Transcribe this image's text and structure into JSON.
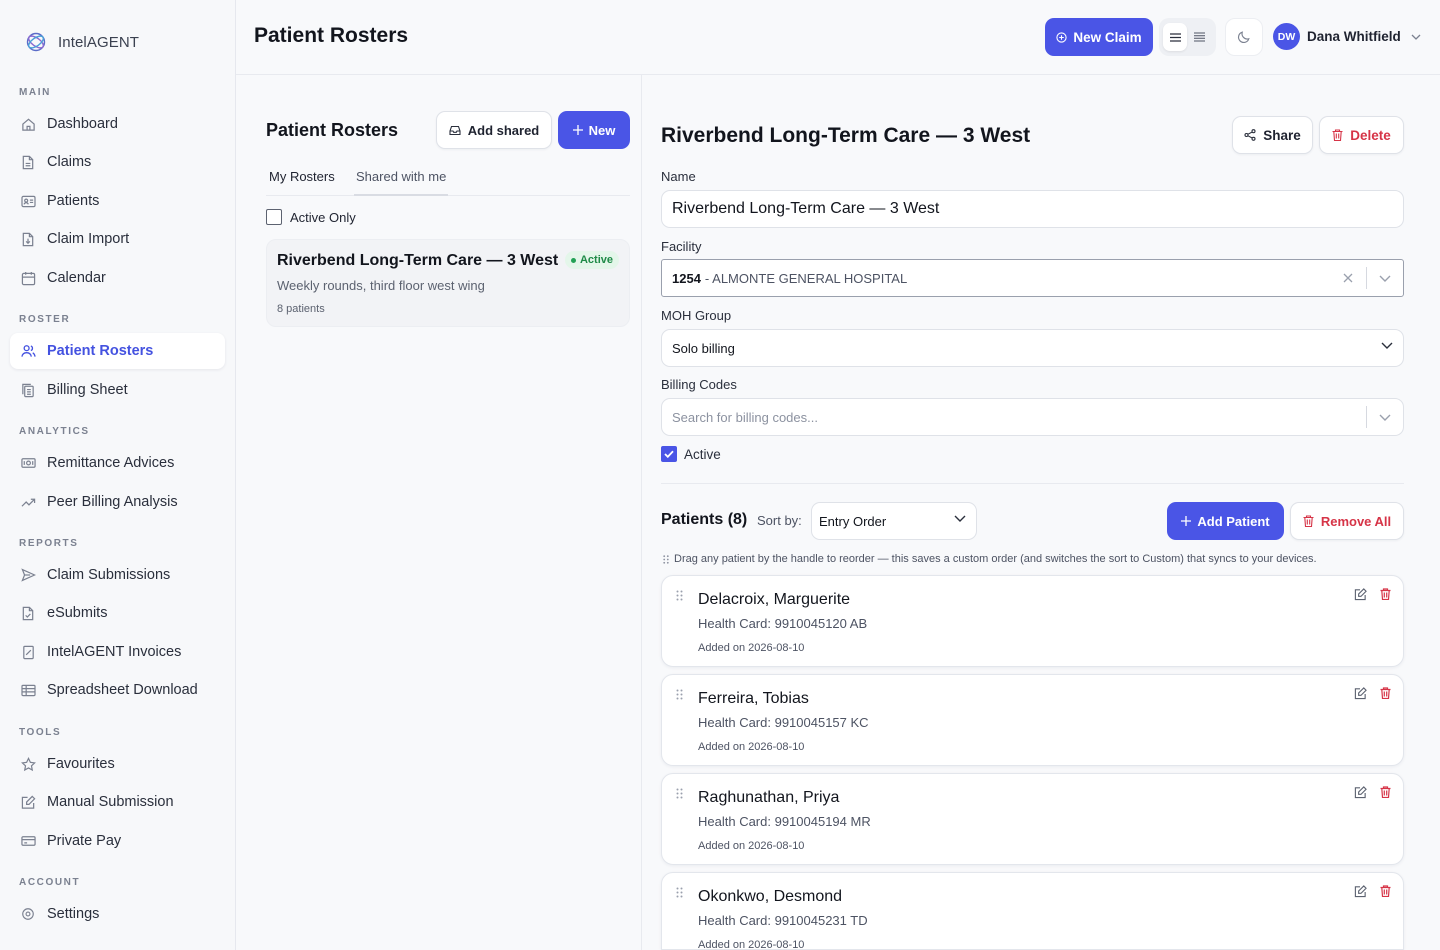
{
  "app": {
    "name": "IntelAGENT"
  },
  "header": {
    "title": "Patient Rosters",
    "new_claim": "New Claim",
    "user": {
      "initials": "DW",
      "name": "Dana Whitfield"
    }
  },
  "sidebar": {
    "sections": {
      "main": "MAIN",
      "roster": "ROSTER",
      "analytics": "ANALYTICS",
      "reports": "REPORTS",
      "tools": "TOOLS",
      "account": "ACCOUNT"
    },
    "items": {
      "dashboard": "Dashboard",
      "claims": "Claims",
      "patients": "Patients",
      "claim_import": "Claim Import",
      "calendar": "Calendar",
      "patient_rosters": "Patient Rosters",
      "billing_sheet": "Billing Sheet",
      "remittance_advices": "Remittance Advices",
      "peer_billing_analysis": "Peer Billing Analysis",
      "claim_submissions": "Claim Submissions",
      "esubmits": "eSubmits",
      "intelagent_invoices": "IntelAGENT Invoices",
      "spreadsheet_download": "Spreadsheet Download",
      "favourites": "Favourites",
      "manual_submission": "Manual Submission",
      "private_pay": "Private Pay",
      "settings": "Settings"
    }
  },
  "roster_list": {
    "title": "Patient Rosters",
    "add_shared": "Add shared",
    "new": "New",
    "tabs": {
      "my": "My Rosters",
      "shared": "Shared with me"
    },
    "active_only": "Active Only",
    "card": {
      "name": "Riverbend Long-Term Care — 3 West",
      "badge": "Active",
      "description": "Weekly rounds, third floor west wing",
      "count": "8 patients"
    }
  },
  "detail": {
    "title": "Riverbend Long-Term Care — 3 West",
    "share": "Share",
    "delete": "Delete",
    "name_label": "Name",
    "name_value": "Riverbend Long-Term Care — 3 West",
    "facility_label": "Facility",
    "facility_code": "1254",
    "facility_name": "- ALMONTE GENERAL HOSPITAL",
    "moh_label": "MOH Group",
    "moh_value": "Solo billing",
    "billing_label": "Billing Codes",
    "billing_placeholder": "Search for billing codes...",
    "active_label": "Active",
    "patients_title": "Patients (8)",
    "sort_label": "Sort by:",
    "sort_value": "Entry Order",
    "add_patient": "Add Patient",
    "remove_all": "Remove All",
    "hint": "Drag any patient by the handle to reorder — this saves a custom order (and switches the sort to Custom) that syncs to your devices."
  },
  "patients": [
    {
      "name": "Delacroix, Marguerite",
      "health_card": "Health Card: 9910045120 AB",
      "added": "Added on 2026-08-10"
    },
    {
      "name": "Ferreira, Tobias",
      "health_card": "Health Card: 9910045157 KC",
      "added": "Added on 2026-08-10"
    },
    {
      "name": "Raghunathan, Priya",
      "health_card": "Health Card: 9910045194 MR",
      "added": "Added on 2026-08-10"
    },
    {
      "name": "Okonkwo, Desmond",
      "health_card": "Health Card: 9910045231 TD",
      "added": "Added on 2026-08-10"
    }
  ],
  "colors": {
    "accent": "#4a55e6",
    "danger": "#d63447",
    "success": "#1e8a47"
  }
}
